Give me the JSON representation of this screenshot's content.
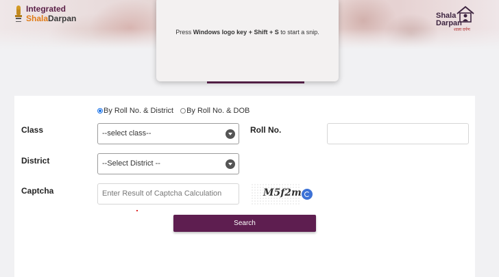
{
  "header": {
    "logo_left_line1": "Integrated",
    "logo_left_line2_prefix": "Shala",
    "logo_left_line2_suffix": "Darpan",
    "logo_right_line1": "Shala",
    "logo_right_line2": "Darpan",
    "logo_right_tag": "शाला दर्पण"
  },
  "snip_tool": {
    "text_prefix": "Press ",
    "text_bold": "Windows logo key + Shift + S",
    "text_suffix": " to start a snip."
  },
  "form": {
    "radio_options": [
      {
        "label": "By Roll No. & District",
        "selected": true
      },
      {
        "label": "By Roll No. & DOB",
        "selected": false
      }
    ],
    "class_label": "Class",
    "class_select_value": "--select class--",
    "roll_label": "Roll No.",
    "roll_value": "",
    "district_label": "District",
    "district_select_value": "--Select District --",
    "captcha_label": "Captcha",
    "captcha_placeholder": "Enter Result of Captcha Calculation",
    "captcha_text": "M5f2mq",
    "search_label": "Search"
  },
  "colors": {
    "brand_purple": "#5e1e50",
    "radio_accent": "#1a73e8",
    "refresh_blue": "#3d72d6"
  },
  "icons": [
    "emblem-icon",
    "school-house-icon",
    "chevron-down-icon",
    "refresh-icon"
  ]
}
